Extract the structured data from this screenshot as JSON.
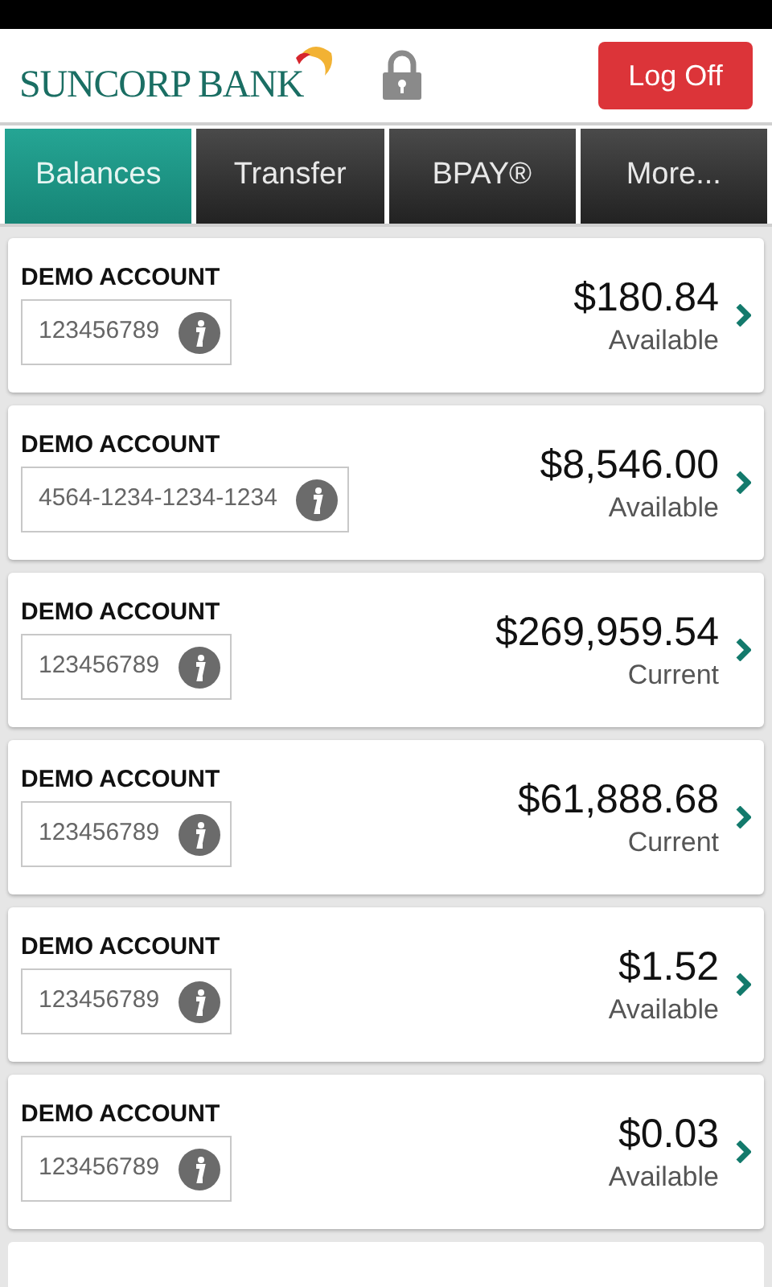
{
  "header": {
    "logo": "SUNCORP BANK",
    "logoff_button": "Log Off"
  },
  "tabs": [
    {
      "label": "Balances",
      "selected": true
    },
    {
      "label": "Transfer",
      "selected": false
    },
    {
      "label": "BPAY®",
      "selected": false
    },
    {
      "label": "More...",
      "selected": false
    }
  ],
  "accounts": [
    {
      "name": "DEMO ACCOUNT",
      "number": "123456789",
      "amount": "$180.84",
      "balance_type": "Available"
    },
    {
      "name": "DEMO ACCOUNT",
      "number": "4564-1234-1234-1234",
      "amount": "$8,546.00",
      "balance_type": "Available"
    },
    {
      "name": "DEMO ACCOUNT",
      "number": "123456789",
      "amount": "$269,959.54",
      "balance_type": "Current"
    },
    {
      "name": "DEMO ACCOUNT",
      "number": "123456789",
      "amount": "$61,888.68",
      "balance_type": "Current"
    },
    {
      "name": "DEMO ACCOUNT",
      "number": "123456789",
      "amount": "$1.52",
      "balance_type": "Available"
    },
    {
      "name": "DEMO ACCOUNT",
      "number": "123456789",
      "amount": "$0.03",
      "balance_type": "Available"
    }
  ]
}
